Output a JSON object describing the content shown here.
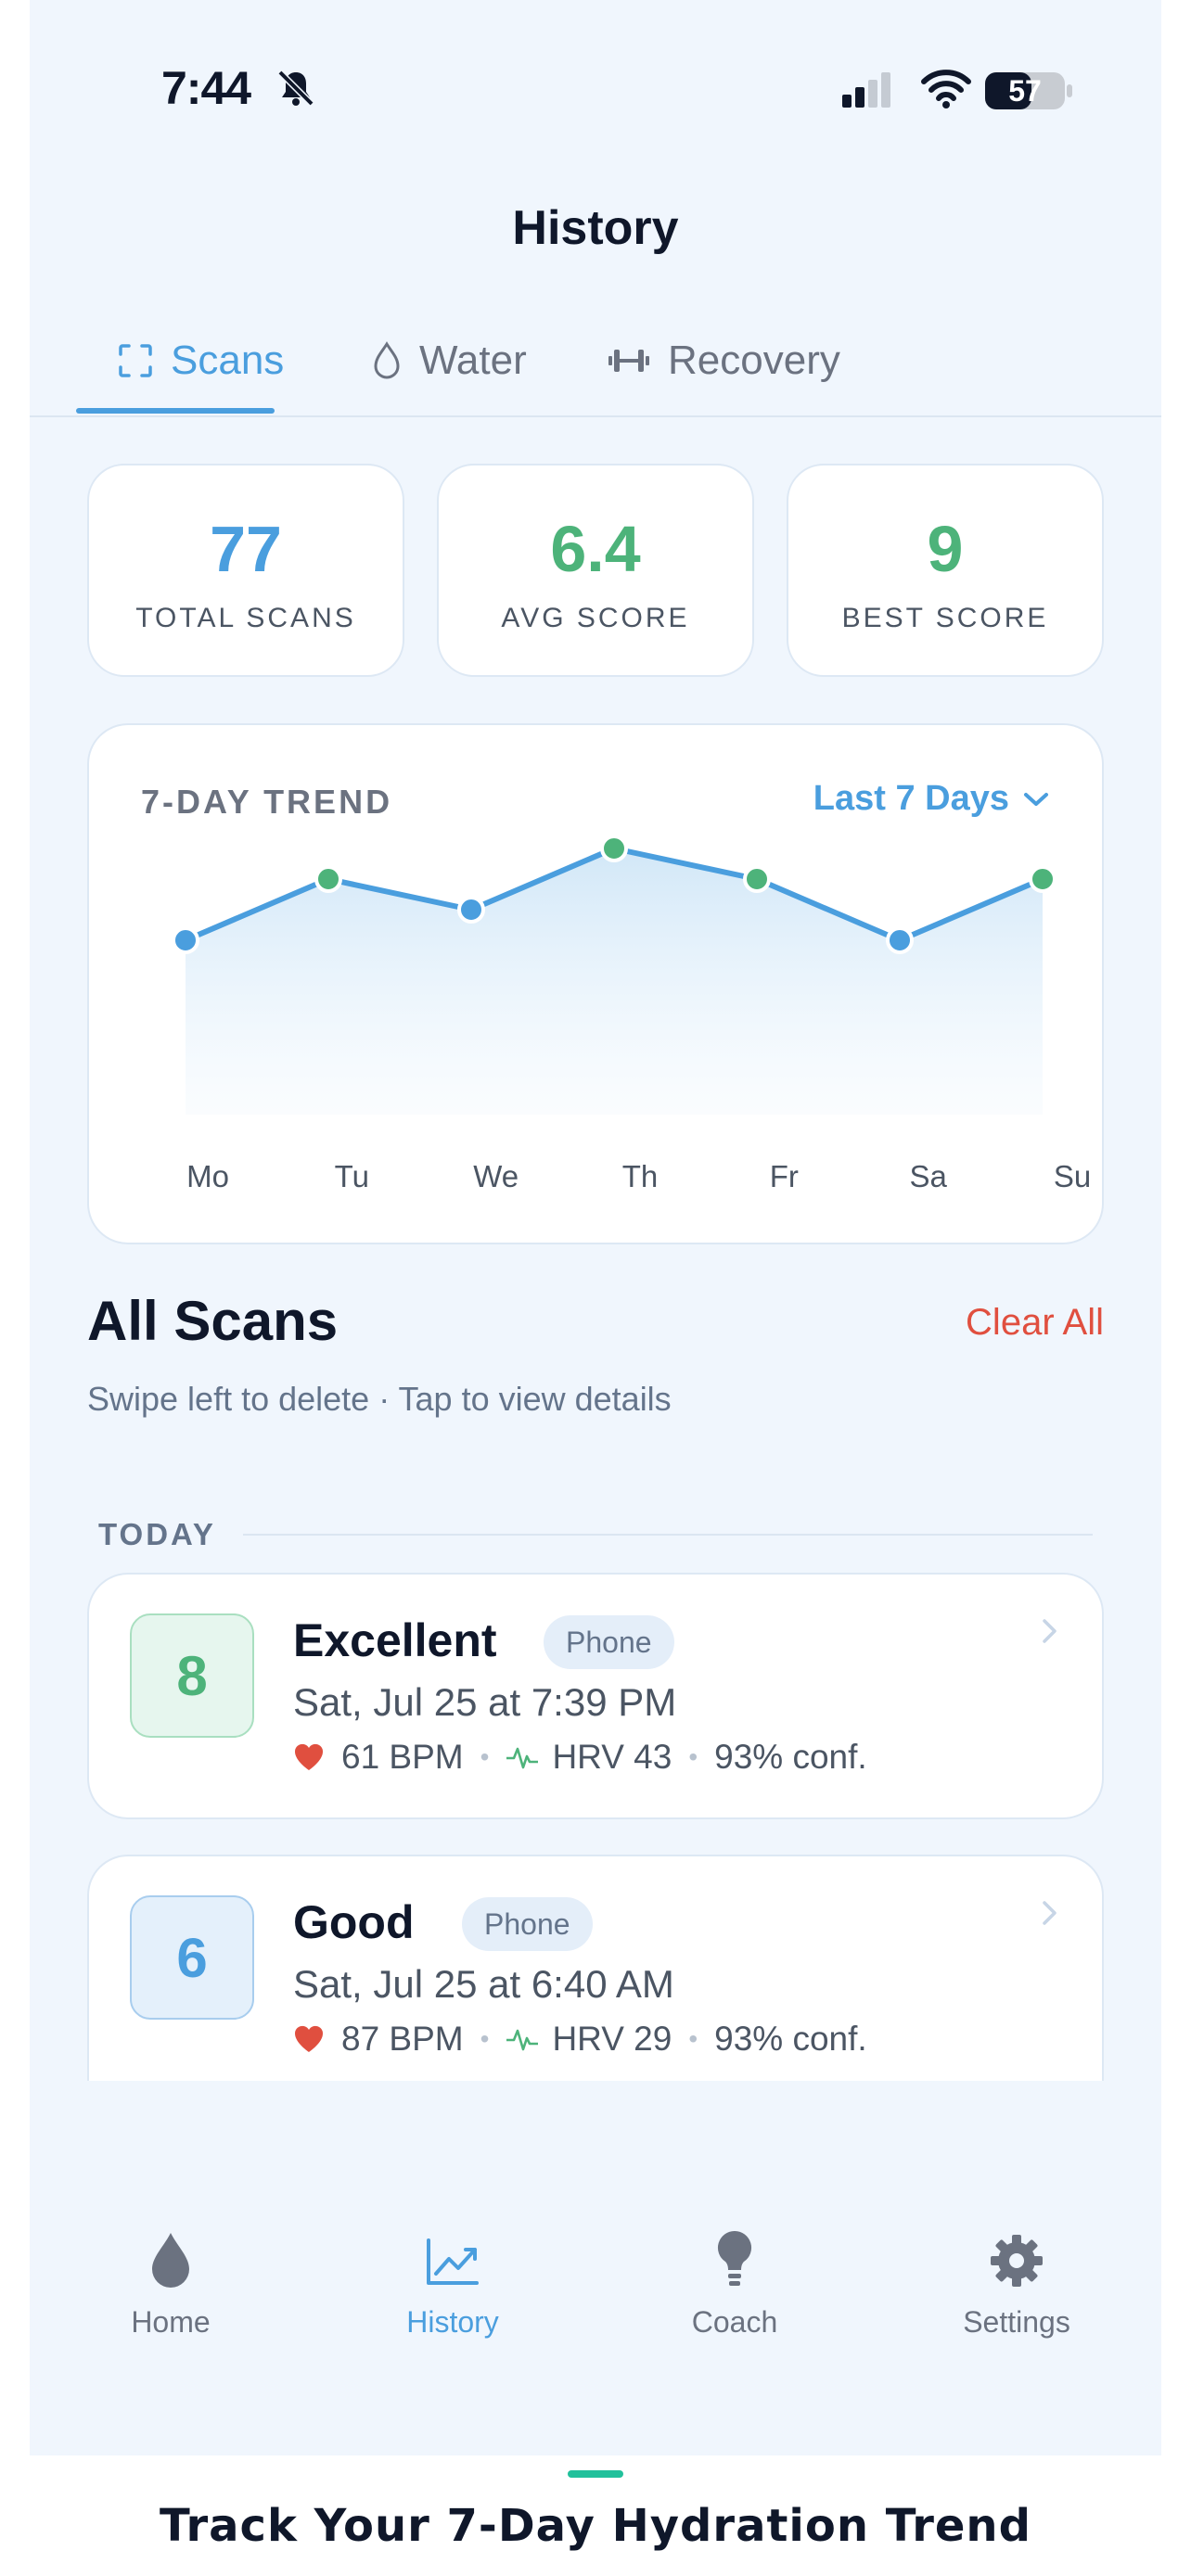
{
  "status_bar": {
    "time": "7:44",
    "battery": "57"
  },
  "page_title": "History",
  "tabs": [
    {
      "label": "Scans",
      "icon": "scan-frame-icon",
      "active": true
    },
    {
      "label": "Water",
      "icon": "water-drop-icon",
      "active": false
    },
    {
      "label": "Recovery",
      "icon": "dumbbell-icon",
      "active": false
    }
  ],
  "stats": [
    {
      "value": "77",
      "label": "TOTAL SCANS",
      "color": "#4a9ede"
    },
    {
      "value": "6.4",
      "label": "AVG SCORE",
      "color": "#4db37a"
    },
    {
      "value": "9",
      "label": "BEST SCORE",
      "color": "#4db37a"
    }
  ],
  "trend": {
    "title": "7-DAY TREND",
    "range_label": "Last 7 Days"
  },
  "chart_data": {
    "type": "area",
    "title": "7-DAY TREND",
    "categories": [
      "Mo",
      "Tu",
      "We",
      "Th",
      "Fr",
      "Sa",
      "Su"
    ],
    "values": [
      6,
      8,
      7,
      9,
      8,
      6,
      8
    ],
    "point_colors": [
      "#4a9ede",
      "#4db37a",
      "#4a9ede",
      "#4db37a",
      "#4db37a",
      "#4a9ede",
      "#4db37a"
    ],
    "line_color": "#4a9ede",
    "ylim": [
      0,
      10
    ],
    "grid": false
  },
  "all_scans": {
    "title": "All Scans",
    "clear_label": "Clear All",
    "hint": "Swipe left to delete · Tap to view details",
    "section_label": "TODAY"
  },
  "scans": [
    {
      "score": "8",
      "label": "Excellent",
      "badge": "Phone",
      "date": "Sat, Jul 25 at 7:39 PM",
      "bpm": "61 BPM",
      "hrv": "HRV 43",
      "conf": "93% conf.",
      "color": "#4db37a",
      "bg": "#e6f6ee",
      "border": "#a9dfc0"
    },
    {
      "score": "6",
      "label": "Good",
      "badge": "Phone",
      "date": "Sat, Jul 25 at 6:40 AM",
      "bpm": "87 BPM",
      "hrv": "HRV 29",
      "conf": "93% conf.",
      "color": "#4a9ede",
      "bg": "#e4f0fb",
      "border": "#a8cdee"
    }
  ],
  "nav": [
    {
      "label": "Home",
      "icon": "drop-icon",
      "active": false
    },
    {
      "label": "History",
      "icon": "chart-line-icon",
      "active": true
    },
    {
      "label": "Coach",
      "icon": "lightbulb-icon",
      "active": false
    },
    {
      "label": "Settings",
      "icon": "gear-icon",
      "active": false
    }
  ],
  "caption": "Track Your 7-Day Hydration Trend"
}
